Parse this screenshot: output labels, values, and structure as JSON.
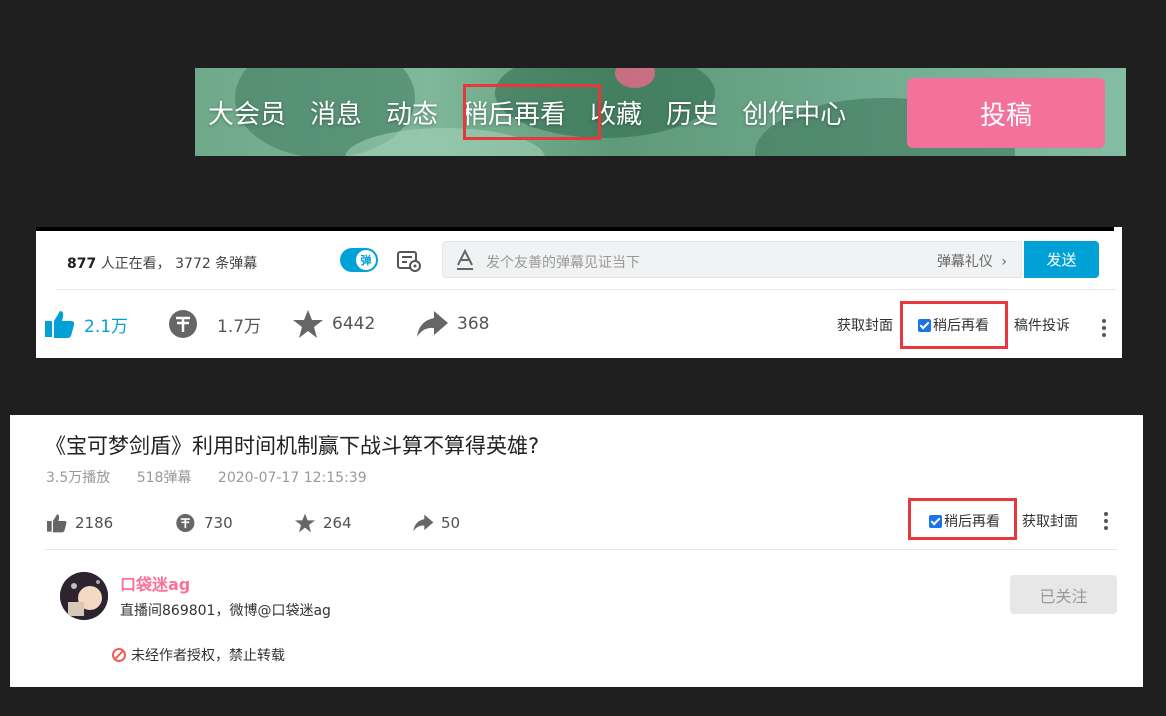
{
  "header": {
    "nav": [
      "大会员",
      "消息",
      "动态",
      "稍后再看",
      "收藏",
      "历史",
      "创作中心"
    ],
    "upload_label": "投稿",
    "highlight_color": "#e5393e",
    "upload_color": "#f2729b"
  },
  "player": {
    "viewers_count": "877",
    "viewers_text": "人正在看，",
    "danmaku_count_text": "3772 条弹幕",
    "toggle_label": "弹",
    "input_placeholder": "发个友善的弹幕见证当下",
    "etiquette_label": "弹幕礼仪",
    "send_label": "发送",
    "accent": "#00a1d6",
    "stats": {
      "like": "2.1万",
      "coin": "1.7万",
      "favorite": "6442",
      "share": "368"
    },
    "get_cover": "获取封面",
    "watch_later": "稍后再看",
    "report": "稿件投诉"
  },
  "video": {
    "title": "《宝可梦剑盾》利用时间机制赢下战斗算不算得英雄?",
    "plays": "3.5万播放",
    "danmaku": "518弹幕",
    "datetime": "2020-07-17 12:15:39",
    "stats": {
      "like": "2186",
      "coin": "730",
      "favorite": "264",
      "share": "50"
    },
    "watch_later": "稍后再看",
    "get_cover": "获取封面",
    "uploader": {
      "name": "口袋迷ag",
      "desc": "直播间869801，微博@口袋迷ag",
      "follow_label": "已关注"
    },
    "copyright_notice": "未经作者授权，禁止转载"
  }
}
